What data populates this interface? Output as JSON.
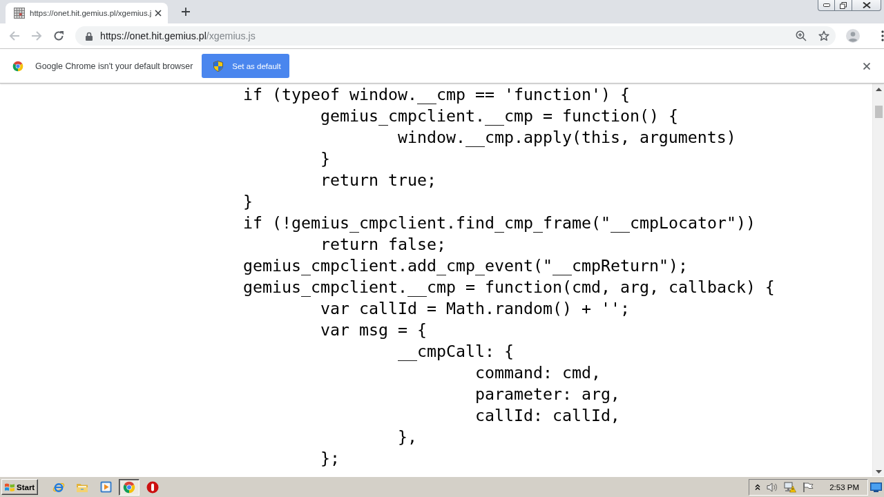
{
  "browser_tabs": [
    {
      "title": "https://onet.hit.gemius.pl/xgemius.j",
      "selected": true
    }
  ],
  "nav_buttons": [
    {
      "kind": "back",
      "disabled": true
    },
    {
      "kind": "forward",
      "disabled": true
    },
    {
      "kind": "reload",
      "disabled": false
    }
  ],
  "address_bar": {
    "host": "https://onet.hit.gemius.pl",
    "path": "/xgemius.js"
  },
  "infobar": {
    "message": "Google Chrome isn't your default browser",
    "button": "Set as default"
  },
  "code_lines": [
    {
      "text": "if (typeof window.__cmp == 'function') {",
      "children": [
        {
          "text": "gemius_cmpclient.__cmp = function() {",
          "children": [
            {
              "text": "window.__cmp.apply(this, arguments)"
            }
          ]
        },
        {
          "text": "}"
        },
        {
          "text": "return true;"
        }
      ]
    },
    {
      "text": "}"
    },
    {
      "text": "if (!gemius_cmpclient.find_cmp_frame(\"__cmpLocator\"))",
      "children": [
        {
          "text": "return false;"
        }
      ]
    },
    {
      "text": "gemius_cmpclient.add_cmp_event(\"__cmpReturn\");"
    },
    {
      "text": "gemius_cmpclient.__cmp = function(cmd, arg, callback) {",
      "children": [
        {
          "text": "var callId = Math.random() + '';"
        },
        {
          "text": "var msg = {",
          "children": [
            {
              "text": "__cmpCall: {",
              "children": [
                {
                  "text": "command: cmd,"
                },
                {
                  "text": "parameter: arg,"
                },
                {
                  "text": "callId: callId,"
                }
              ]
            },
            {
              "text": "},"
            }
          ]
        },
        {
          "text": "};"
        }
      ]
    }
  ],
  "taskbar": {
    "start": "Start",
    "apps": [
      {
        "kind": "browser_e",
        "selected": false
      },
      {
        "kind": "folder",
        "selected": false
      },
      {
        "kind": "media_player",
        "selected": false
      },
      {
        "kind": "chrome",
        "selected": true
      },
      {
        "kind": "circle_bar",
        "selected": false
      }
    ],
    "clock": "2:53 PM"
  }
}
